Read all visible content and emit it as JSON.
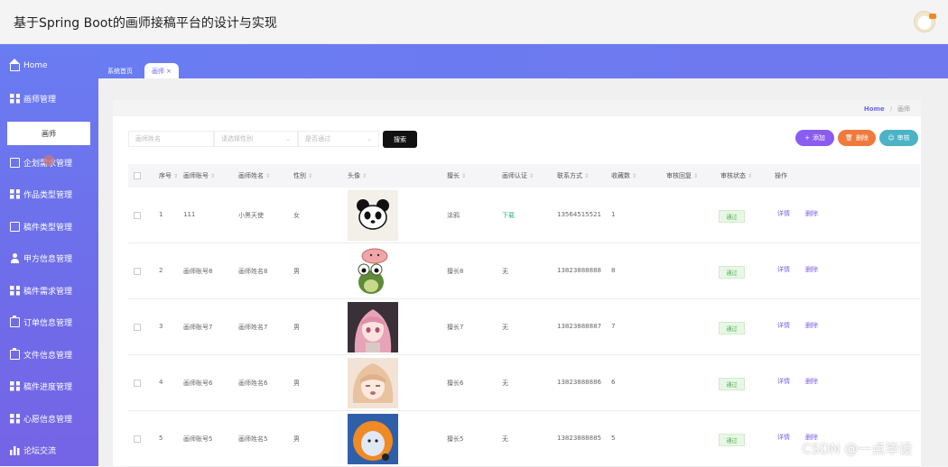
{
  "header": {
    "title": "基于Spring Boot的画师接稿平台的设计与实现",
    "avatar_icon": "user-avatar"
  },
  "sidebar": {
    "items": [
      {
        "label": "Home",
        "icon": "home-icon"
      },
      {
        "label": "画师管理",
        "icon": "grid-icon"
      },
      {
        "label": "企划需求管理",
        "icon": "box-icon"
      },
      {
        "label": "作品类型管理",
        "icon": "grid-icon"
      },
      {
        "label": "稿件类型管理",
        "icon": "box-icon"
      },
      {
        "label": "甲方信息管理",
        "icon": "user-icon"
      },
      {
        "label": "稿件需求管理",
        "icon": "grid-icon"
      },
      {
        "label": "订单信息管理",
        "icon": "clipboard-icon"
      },
      {
        "label": "文件信息管理",
        "icon": "clipboard-icon"
      },
      {
        "label": "稿件进度管理",
        "icon": "grid-icon"
      },
      {
        "label": "心愿信息管理",
        "icon": "grid-icon"
      },
      {
        "label": "论坛交流",
        "icon": "bars-icon"
      }
    ],
    "submenu_label": "画师"
  },
  "tabs": {
    "home": "系统首页",
    "active": "画师",
    "close": "×"
  },
  "breadcrumb": {
    "home": "Home",
    "sep": "/",
    "current": "画师"
  },
  "filters": {
    "name_placeholder": "画师姓名",
    "gender_placeholder": "请选择性别",
    "status_placeholder": "是否通过",
    "search_label": "搜索"
  },
  "actions": {
    "add": "添加",
    "delete": "删除",
    "audit": "审核"
  },
  "table": {
    "headers": [
      "序号",
      "画师账号",
      "画师姓名",
      "性别",
      "头像",
      "擅长",
      "画师认证",
      "联系方式",
      "收藏数",
      "审核回复",
      "审核状态",
      "操作"
    ],
    "rows": [
      {
        "no": "1",
        "account": "111",
        "name": "小黑天使",
        "gender": "女",
        "avatar": "panda",
        "skill": "涂鸦",
        "cert": "下载",
        "phone": "13564515521",
        "fav": "1",
        "reply": "",
        "status": "通过",
        "detail": "详情",
        "delete": "删除"
      },
      {
        "no": "2",
        "account": "画师账号8",
        "name": "画师姓名8",
        "gender": "男",
        "avatar": "frog",
        "skill": "擅长8",
        "cert": "无",
        "phone": "13823888888",
        "fav": "8",
        "reply": "",
        "status": "通过",
        "detail": "详情",
        "delete": "删除"
      },
      {
        "no": "3",
        "account": "画师账号7",
        "name": "画师姓名7",
        "gender": "男",
        "avatar": "anime-girl",
        "skill": "擅长7",
        "cert": "无",
        "phone": "13823888887",
        "fav": "7",
        "reply": "",
        "status": "通过",
        "detail": "详情",
        "delete": "删除"
      },
      {
        "no": "4",
        "account": "画师账号6",
        "name": "画师姓名6",
        "gender": "男",
        "avatar": "blonde-girl",
        "skill": "擅长6",
        "cert": "无",
        "phone": "13823888886",
        "fav": "6",
        "reply": "",
        "status": "通过",
        "detail": "详情",
        "delete": "删除"
      },
      {
        "no": "5",
        "account": "画师账号5",
        "name": "画师姓名5",
        "gender": "男",
        "avatar": "hooded-character",
        "skill": "擅长5",
        "cert": "无",
        "phone": "13823888885",
        "fav": "5",
        "reply": "",
        "status": "通过",
        "detail": "详情",
        "delete": "删除"
      }
    ]
  },
  "watermark": "CSDN @一点毕设",
  "colors": {
    "accent": "#6a7cf2",
    "primary_purple": "#7b5ce6",
    "success": "#4caa48",
    "warning": "#f07a3c",
    "info": "#4cb3c6"
  }
}
